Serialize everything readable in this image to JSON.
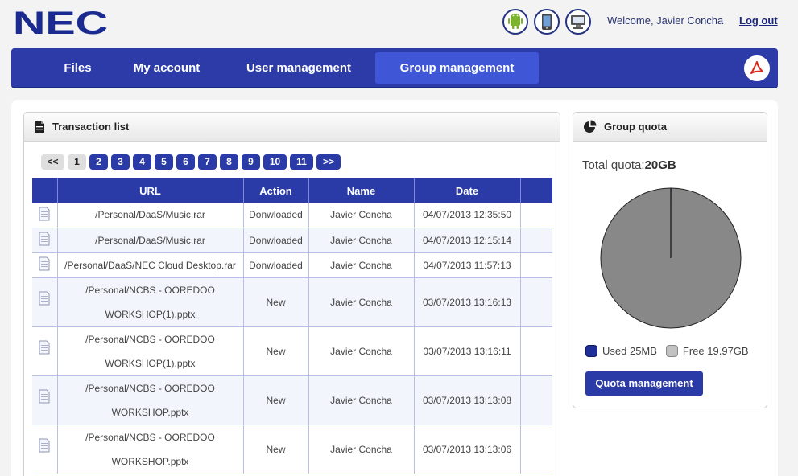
{
  "header": {
    "logo_text": "NEC",
    "welcome": "Welcome, Javier Concha",
    "logout": "Log out",
    "icons": [
      "android-icon",
      "mobile-phone-icon",
      "desktop-icon"
    ]
  },
  "nav": {
    "items": [
      "Files",
      "My account",
      "User management",
      "Group management"
    ],
    "active": "Group management",
    "pdf_icon": "pdf-icon"
  },
  "transactions": {
    "title": "Transaction list",
    "pager": {
      "first": "<<",
      "pages": [
        "1",
        "2",
        "3",
        "4",
        "5",
        "6",
        "7",
        "8",
        "9",
        "10",
        "11"
      ],
      "current": "1",
      "last": ">>"
    },
    "columns": [
      "",
      "URL",
      "Action",
      "Name",
      "Date",
      ""
    ],
    "rows": [
      {
        "url": "/Personal/DaaS/Music.rar",
        "url2": "",
        "action": "Donwloaded",
        "name": "Javier Concha",
        "date": "04/07/2013 12:35:50"
      },
      {
        "url": "/Personal/DaaS/Music.rar",
        "url2": "",
        "action": "Donwloaded",
        "name": "Javier Concha",
        "date": "04/07/2013 12:15:14"
      },
      {
        "url": "/Personal/DaaS/NEC Cloud Desktop.rar",
        "url2": "",
        "action": "Donwloaded",
        "name": "Javier Concha",
        "date": "04/07/2013 11:57:13"
      },
      {
        "url": "/Personal/NCBS - OOREDOO",
        "url2": "WORKSHOP(1).pptx",
        "action": "New",
        "name": "Javier Concha",
        "date": "03/07/2013 13:16:13"
      },
      {
        "url": "/Personal/NCBS - OOREDOO",
        "url2": "WORKSHOP(1).pptx",
        "action": "New",
        "name": "Javier Concha",
        "date": "03/07/2013 13:16:11"
      },
      {
        "url": "/Personal/NCBS - OOREDOO",
        "url2": "WORKSHOP.pptx",
        "action": "New",
        "name": "Javier Concha",
        "date": "03/07/2013 13:13:08"
      },
      {
        "url": "/Personal/NCBS - OOREDOO",
        "url2": "WORKSHOP.pptx",
        "action": "New",
        "name": "Javier Concha",
        "date": "03/07/2013 13:13:06"
      }
    ]
  },
  "quota": {
    "title": "Group quota",
    "total_label": "Total quota:",
    "total_value": "20GB",
    "used_label": "Used 25MB",
    "free_label": "Free 19.97GB",
    "used_fraction": 0.00122,
    "colors": {
      "used": "#1f2f9a",
      "free": "#888888"
    },
    "button": "Quota management"
  }
}
